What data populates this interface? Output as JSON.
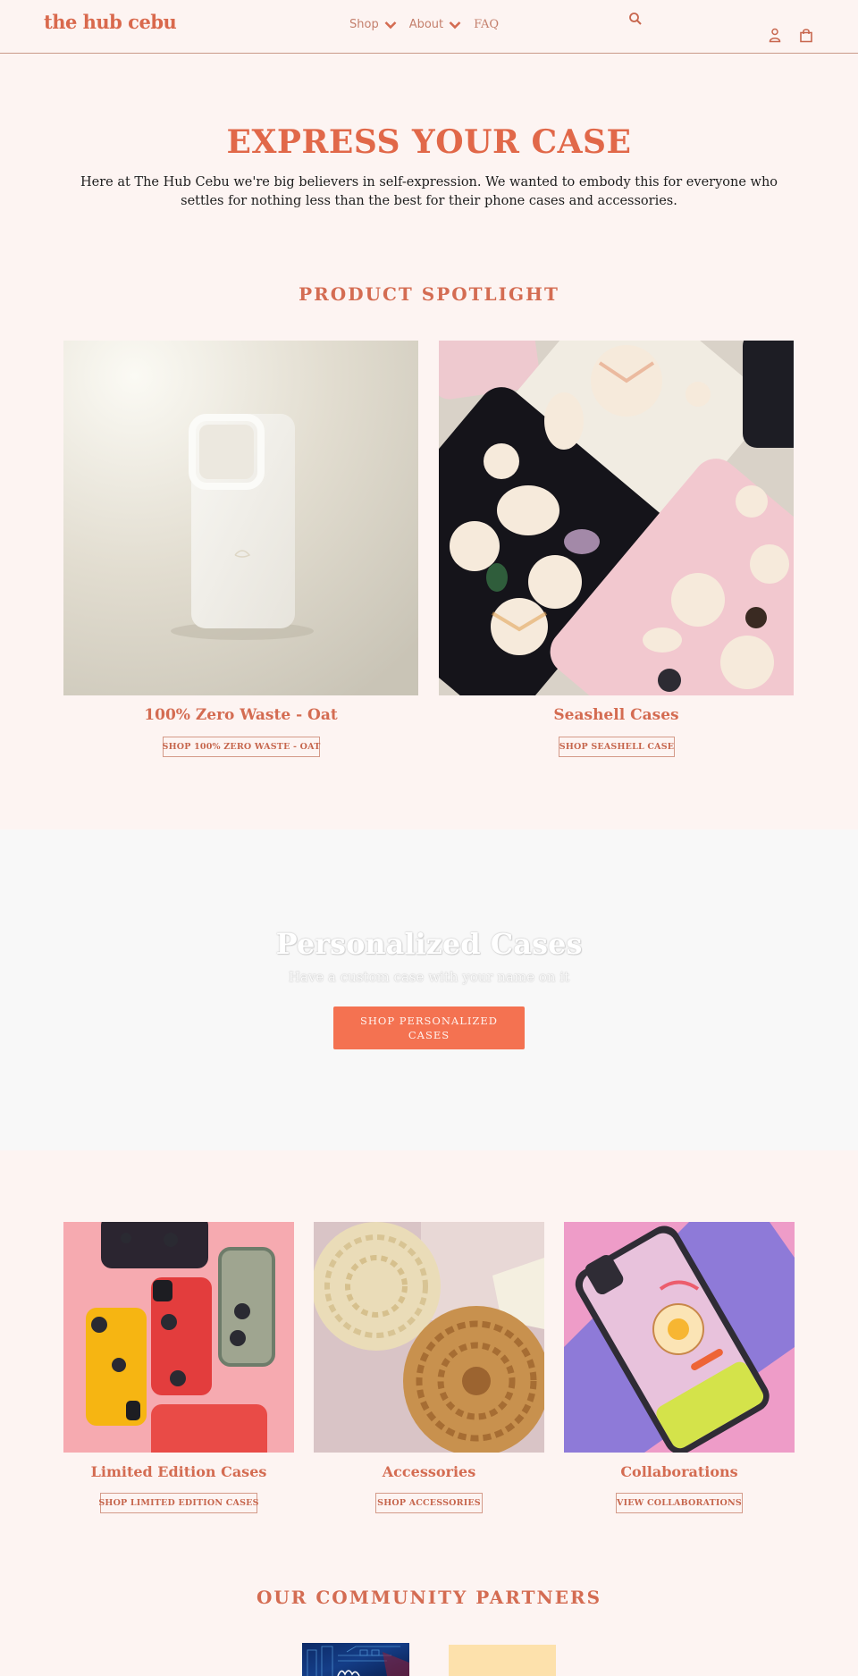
{
  "header": {
    "logo": "the hub cebu",
    "nav": [
      {
        "label": "Shop",
        "has_dropdown": true
      },
      {
        "label": "About",
        "has_dropdown": true
      },
      {
        "label": "FAQ",
        "has_dropdown": false
      }
    ],
    "icons": [
      "search-icon",
      "user-icon",
      "cart-icon"
    ]
  },
  "hero": {
    "title": "EXPRESS YOUR CASE",
    "text": "Here at The Hub Cebu we're big believers in self-expression. We wanted to embody this for everyone who settles for nothing less than the best for their phone cases and accessories."
  },
  "spotlight": {
    "title": "PRODUCT SPOTLIGHT",
    "products": [
      {
        "name": "100% Zero Waste - Oat",
        "button": "SHOP 100% ZERO WASTE - OAT",
        "image": "oat-phone-case-photo"
      },
      {
        "name": "Seashell Cases",
        "button": "SHOP SEASHELL CASE",
        "image": "seashell-cases-photo"
      }
    ]
  },
  "banner": {
    "title": "Personalized Cases",
    "subtitle": "Have a custom case with your name on it",
    "button": "SHOP PERSONALIZED CASES"
  },
  "categories": [
    {
      "name": "Limited Edition Cases",
      "button": "SHOP LIMITED EDITION CASES",
      "image": "limited-edition-cases-photo"
    },
    {
      "name": "Accessories",
      "button": "SHOP ACCESSORIES",
      "image": "rattan-coasters-photo"
    },
    {
      "name": "Collaborations",
      "button": "VIEW COLLABORATIONS",
      "image": "growth-season-case-photo"
    }
  ],
  "partners": {
    "title": "OUR COMMUNITY PARTNERS",
    "logos": [
      "partner-logo-city",
      "partner-logo-yellow"
    ]
  },
  "colors": {
    "accent": "#e16849",
    "background": "#fdf4f2",
    "cta": "#f47251",
    "banner_bg": "#f8f8f8"
  }
}
